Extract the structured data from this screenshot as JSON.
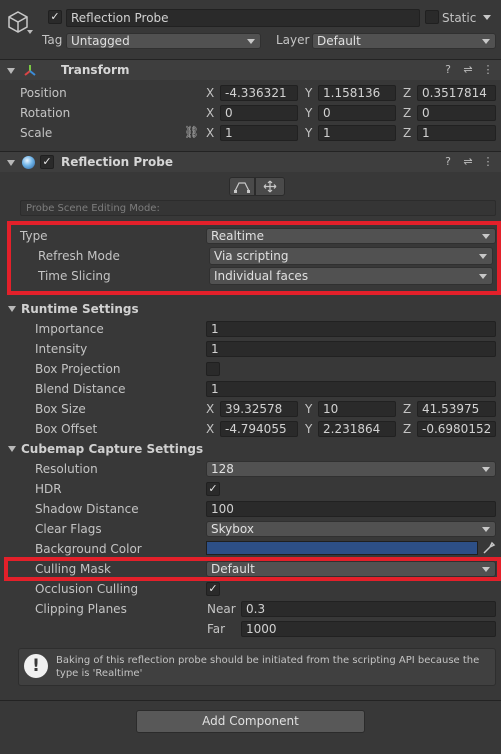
{
  "header": {
    "object_name": "Reflection Probe",
    "static_label": "Static",
    "tag_label": "Tag",
    "tag_value": "Untagged",
    "layer_label": "Layer",
    "layer_value": "Default"
  },
  "transform": {
    "title": "Transform",
    "position_label": "Position",
    "rotation_label": "Rotation",
    "scale_label": "Scale",
    "axes": [
      "X",
      "Y",
      "Z"
    ],
    "position": [
      "-4.336321",
      "1.158136",
      "0.3517814"
    ],
    "rotation": [
      "0",
      "0",
      "0"
    ],
    "scale": [
      "1",
      "1",
      "1"
    ]
  },
  "probe": {
    "title": "Reflection Probe",
    "edit_mode_text": "Probe Scene Editing Mode:",
    "type_label": "Type",
    "type_value": "Realtime",
    "refresh_label": "Refresh Mode",
    "refresh_value": "Via scripting",
    "slicing_label": "Time Slicing",
    "slicing_value": "Individual faces"
  },
  "runtime": {
    "title": "Runtime Settings",
    "importance_label": "Importance",
    "importance_value": "1",
    "intensity_label": "Intensity",
    "intensity_value": "1",
    "box_projection_label": "Box Projection",
    "blend_label": "Blend Distance",
    "blend_value": "1",
    "box_size_label": "Box Size",
    "box_size": [
      "39.32578",
      "10",
      "41.53975"
    ],
    "box_offset_label": "Box Offset",
    "box_offset": [
      "-4.794055",
      "2.231864",
      "-0.6980152"
    ]
  },
  "cubemap": {
    "title": "Cubemap Capture Settings",
    "resolution_label": "Resolution",
    "resolution_value": "128",
    "hdr_label": "HDR",
    "shadow_label": "Shadow Distance",
    "shadow_value": "100",
    "clear_label": "Clear Flags",
    "clear_value": "Skybox",
    "bg_label": "Background Color",
    "bg_color": "#2d4f86",
    "culling_label": "Culling Mask",
    "culling_value": "Default",
    "occlusion_label": "Occlusion Culling",
    "clipping_label": "Clipping Planes",
    "near_label": "Near",
    "near_value": "0.3",
    "far_label": "Far",
    "far_value": "1000"
  },
  "warning": {
    "text": "Baking of this reflection probe should be initiated from the scripting API because the type is 'Realtime'"
  },
  "footer": {
    "add_component": "Add Component"
  },
  "colors": {
    "highlight": "#e3202a",
    "panel": "#383838"
  }
}
